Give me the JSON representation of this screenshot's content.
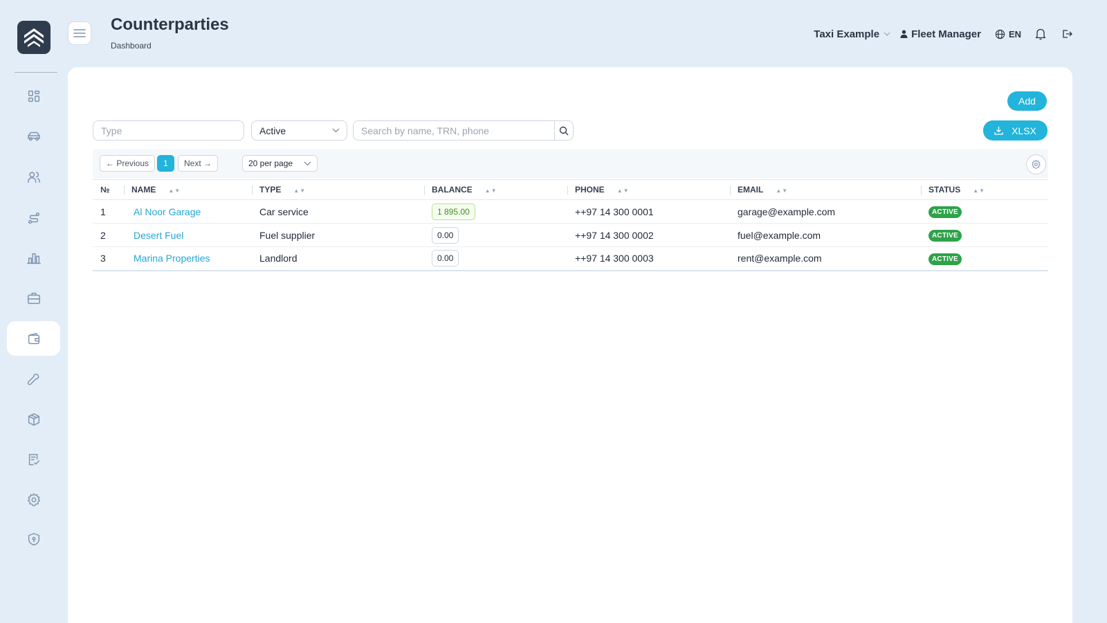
{
  "header": {
    "title": "Counterparties",
    "breadcrumb": "Dashboard",
    "company": "Taxi Example",
    "user": "Fleet Manager",
    "language": "EN"
  },
  "toolbar": {
    "add_label": "Add",
    "export_label": "XLSX",
    "type_placeholder": "Type",
    "status_value": "Active",
    "search_placeholder": "Search by name, TRN, phone"
  },
  "pagination": {
    "previous_label": "← Previous",
    "current_page": "1",
    "next_label": "Next →",
    "per_page": "20 per page"
  },
  "table": {
    "columns": [
      "№",
      "NAME",
      "TYPE",
      "BALANCE",
      "PHONE",
      "EMAIL",
      "STATUS"
    ],
    "rows": [
      {
        "num": "1",
        "name": "Al Noor Garage",
        "type": "Car service",
        "balance": "1 895.00",
        "phone": "++97 14 300 0001",
        "email": "garage@example.com",
        "status": "ACTIVE"
      },
      {
        "num": "2",
        "name": "Desert Fuel",
        "type": "Fuel supplier",
        "balance": "0.00",
        "phone": "++97 14 300 0002",
        "email": "fuel@example.com",
        "status": "ACTIVE"
      },
      {
        "num": "3",
        "name": "Marina Properties",
        "type": "Landlord",
        "balance": "0.00",
        "phone": "++97 14 300 0003",
        "email": "rent@example.com",
        "status": "ACTIVE"
      }
    ]
  },
  "sidebar": {
    "icons": [
      "dashboard-icon",
      "car-icon",
      "users-icon",
      "route-icon",
      "chart-icon",
      "briefcase-icon",
      "wallet-icon",
      "wrench-icon",
      "box-icon",
      "checklist-icon",
      "gear-icon",
      "shield-icon"
    ],
    "active": "wallet-icon"
  },
  "colors": {
    "accent": "#22b4db",
    "status_active": "#2ea24a",
    "background": "#e3edf7"
  }
}
